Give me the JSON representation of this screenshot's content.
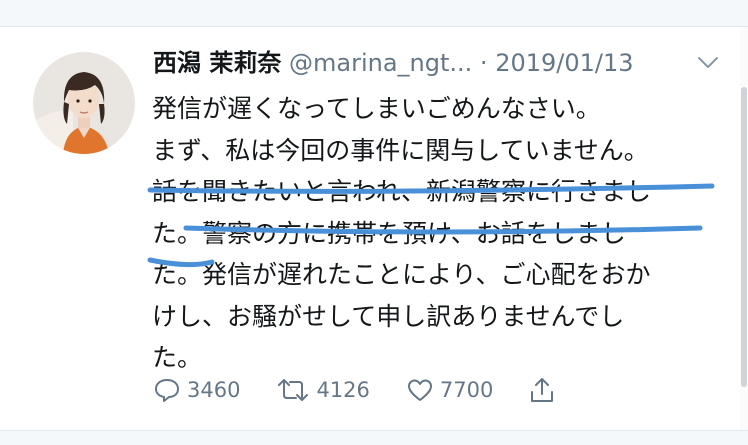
{
  "tweet": {
    "display_name": "西潟 茉莉奈",
    "handle": "@marina_ngt...",
    "separator": "·",
    "date": "2019/01/13",
    "text_lines": [
      "発信が遅くなってしまいごめんなさい。",
      "まず、私は今回の事件に関与していません。",
      "話を聞きたいと言われ、新潟警察に行きまし",
      "た。警察の方に携帯を預け、お話をしまし",
      "た。発信が遅れたことにより、ご心配をおか",
      "けし、お騒がせして申し訳ありませんでし",
      "た。"
    ],
    "underline_color": "#4a90d9"
  },
  "actions": {
    "reply_count": "3460",
    "retweet_count": "4126",
    "like_count": "7700"
  },
  "icons": {
    "reply": "reply-icon",
    "retweet": "retweet-icon",
    "like": "heart-icon",
    "share": "share-icon",
    "menu": "chevron-down-icon"
  }
}
